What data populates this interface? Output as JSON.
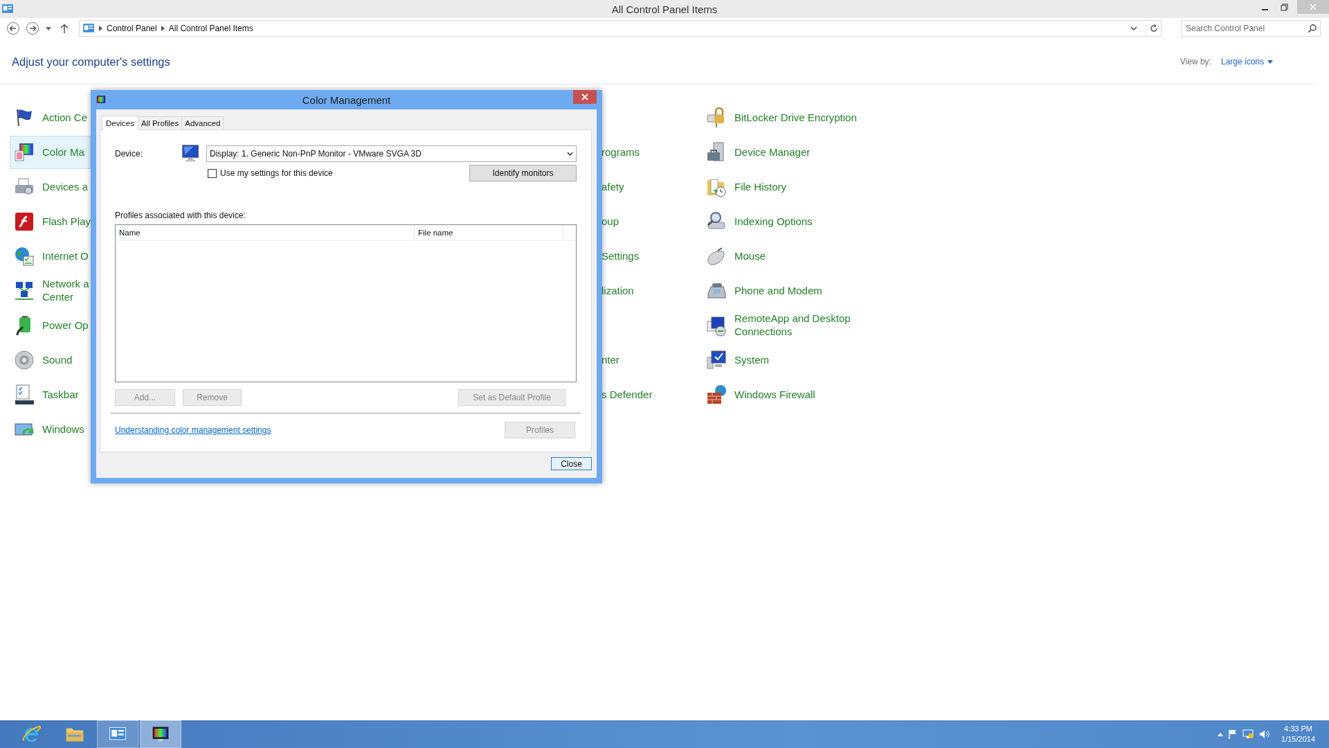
{
  "window": {
    "title": "All Control Panel Items"
  },
  "address_bar": {
    "breadcrumbs": [
      "Control Panel",
      "All Control Panel Items"
    ]
  },
  "search": {
    "placeholder": "Search Control Panel"
  },
  "heading": "Adjust your computer's settings",
  "view_by": {
    "label": "View by:",
    "value": "Large icons"
  },
  "rows": [
    {
      "left": {
        "label": "Action Ce",
        "selected": false
      },
      "right": {
        "label": "BitLocker Drive Encryption",
        "selected": false
      }
    },
    {
      "left": {
        "label": "Color Ma",
        "selected": true
      },
      "middle": {
        "label": "rograms",
        "selected": false
      },
      "right": {
        "label": "Device Manager",
        "selected": false
      }
    },
    {
      "left": {
        "label": "Devices a",
        "selected": false
      },
      "middle": {
        "label": "afety",
        "selected": false
      },
      "right": {
        "label": "File History",
        "selected": false
      }
    },
    {
      "left": {
        "label": "Flash Play",
        "selected": false
      },
      "middle": {
        "label": "oup",
        "selected": false
      },
      "right": {
        "label": "Indexing Options",
        "selected": false
      }
    },
    {
      "left": {
        "label": "Internet O",
        "selected": false
      },
      "middle": {
        "label": "Settings",
        "selected": false
      },
      "right": {
        "label": "Mouse",
        "selected": false
      }
    },
    {
      "left": {
        "label": "Network a\nCenter",
        "selected": false
      },
      "middle": {
        "label": "lization",
        "selected": false
      },
      "right": {
        "label": "Phone and Modem",
        "selected": false
      }
    },
    {
      "left": {
        "label": "Power Op",
        "selected": false
      },
      "right": {
        "label": "RemoteApp and Desktop\nConnections",
        "selected": false
      }
    },
    {
      "left": {
        "label": "Sound",
        "selected": false
      },
      "middle": {
        "label": "nter",
        "selected": false
      },
      "right": {
        "label": "System",
        "selected": false
      }
    },
    {
      "left": {
        "label": "Taskbar",
        "selected": false
      },
      "middle": {
        "label": "s Defender",
        "selected": false
      },
      "right": {
        "label": "Windows Firewall",
        "selected": false
      }
    },
    {
      "left": {
        "label": "Windows",
        "selected": false
      }
    }
  ],
  "dialog": {
    "title": "Color Management",
    "tabs": [
      {
        "label": "Devices",
        "selected": true
      },
      {
        "label": "All Profiles",
        "selected": false
      },
      {
        "label": "Advanced",
        "selected": false
      }
    ],
    "device_label": "Device:",
    "device_value": "Display: 1. Generic Non-PnP Monitor - VMware SVGA 3D",
    "use_my_settings": {
      "label": "Use my settings for this device",
      "checked": false
    },
    "identify_button": "Identify monitors",
    "profiles_label": "Profiles associated with this device:",
    "profiles_table": {
      "columns": [
        "Name",
        "File name"
      ]
    },
    "buttons": [
      {
        "label": "Add...",
        "disabled": true
      },
      {
        "label": "Remove",
        "disabled": true
      },
      {
        "label": "Set as Default Profile",
        "disabled": true
      }
    ],
    "link": "Understanding color management settings",
    "profiles_button": {
      "label": "Profiles",
      "disabled": true
    },
    "close_button": "Close"
  },
  "taskbar": {
    "apps": [
      {
        "running": false,
        "selected": false
      },
      {
        "running": false,
        "selected": false
      },
      {
        "running": true,
        "selected": false
      },
      {
        "running": true,
        "selected": true
      }
    ]
  },
  "clock": {
    "time": "4:33 PM",
    "date": "1/15/2014"
  }
}
